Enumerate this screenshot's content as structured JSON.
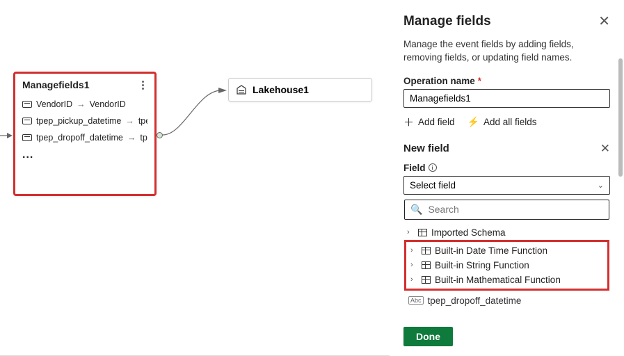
{
  "canvas": {
    "managefields_node": {
      "title": "Managefields1",
      "rows": [
        {
          "from": "VendorID",
          "to": "VendorID"
        },
        {
          "from": "tpep_pickup_datetime",
          "to": "tpe"
        },
        {
          "from": "tpep_dropoff_datetime",
          "to": "tp"
        }
      ],
      "more": "..."
    },
    "lakehouse_node": {
      "title": "Lakehouse1"
    }
  },
  "panel": {
    "title": "Manage fields",
    "description": "Manage the event fields by adding fields, removing fields, or updating field names.",
    "operation_name_label": "Operation name",
    "operation_name_value": "Managefields1",
    "add_field_label": "Add field",
    "add_all_fields_label": "Add all fields",
    "new_field_heading": "New field",
    "field_label": "Field",
    "select_placeholder": "Select field",
    "search_placeholder": "Search",
    "tree_items": [
      "Imported Schema",
      "Built-in Date Time Function",
      "Built-in String Function",
      "Built-in Mathematical Function"
    ],
    "result_item": "tpep_dropoff_datetime",
    "done_label": "Done"
  }
}
